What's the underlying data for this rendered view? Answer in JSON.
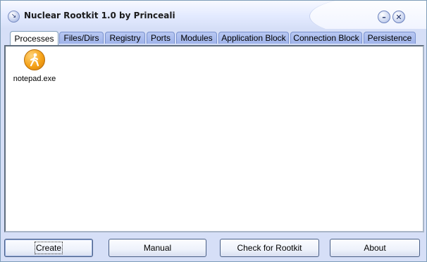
{
  "window": {
    "title": "Nuclear Rootkit 1.0 by Princeali",
    "icon": "arrow-icon",
    "controls": {
      "minimize": "–",
      "close": "✕"
    }
  },
  "tabs": [
    {
      "label": "Processes",
      "active": true
    },
    {
      "label": "Files/Dirs",
      "active": false
    },
    {
      "label": "Registry",
      "active": false
    },
    {
      "label": "Ports",
      "active": false
    },
    {
      "label": "Modules",
      "active": false
    },
    {
      "label": "Application Block",
      "active": false
    },
    {
      "label": "Connection Block",
      "active": false
    },
    {
      "label": "Persistence",
      "active": false
    }
  ],
  "processes": [
    {
      "name": "notepad.exe",
      "icon": "walking-person-icon"
    }
  ],
  "buttons": {
    "create": "Create",
    "manual": "Manual",
    "check": "Check for Rootkit",
    "about": "About"
  },
  "colors": {
    "window_bg": "#d6dff7",
    "tab_bg": "#a8bbee",
    "process_icon": "#f5a218"
  }
}
